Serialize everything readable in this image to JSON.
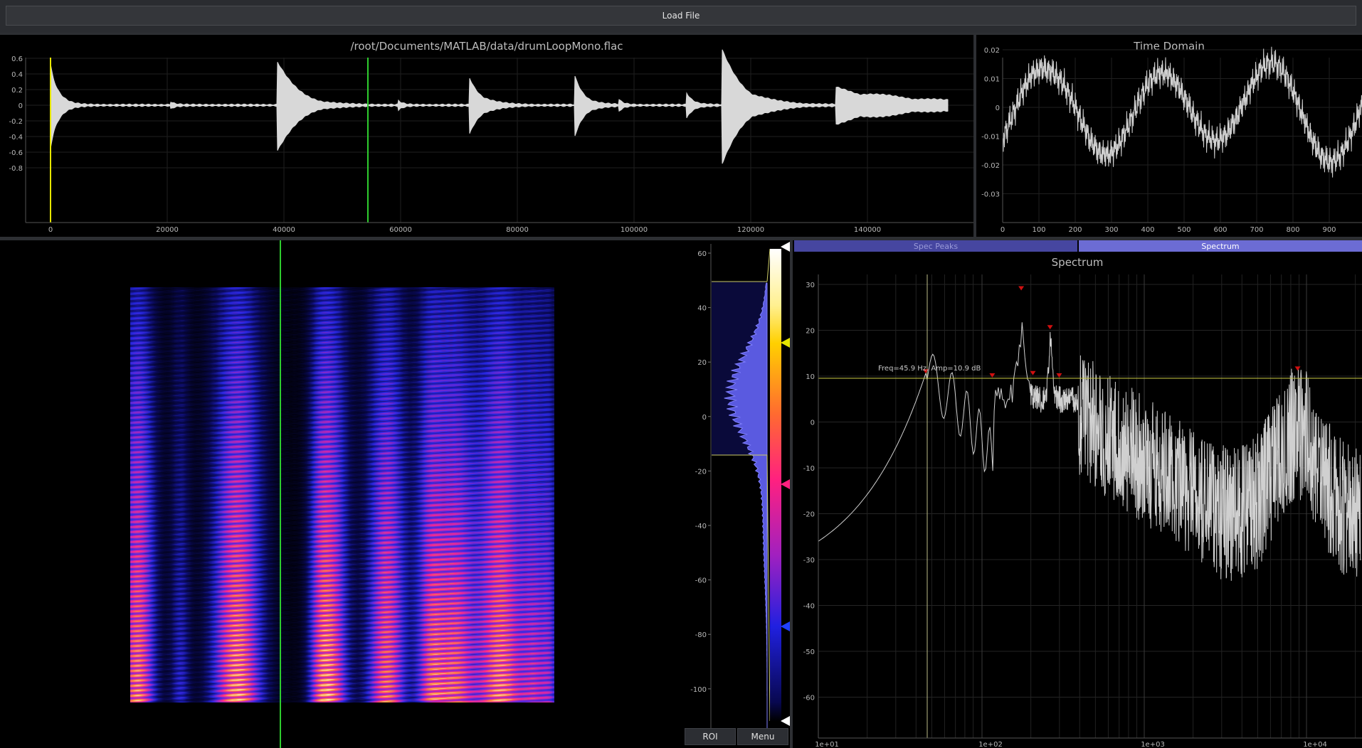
{
  "toolbar": {
    "load_label": "Load File"
  },
  "waveform": {
    "title": "/root/Documents/MATLAB/data/drumLoopMono.flac",
    "y_ticks": [
      "0.6",
      "0.4",
      "0.2",
      "0",
      "-0.2",
      "-0.4",
      "-0.6",
      "-0.8"
    ],
    "x_ticks": [
      "0",
      "20000",
      "40000",
      "60000",
      "80000",
      "100000",
      "140000"
    ],
    "x_ticks_full": [
      "0",
      "20000",
      "40000",
      "60000",
      "80000",
      "100000",
      "120000",
      "140000"
    ]
  },
  "time_domain": {
    "title": "Time Domain",
    "y_ticks": [
      "0.02",
      "0.01",
      "0",
      "-0.01",
      "-0.02",
      "-0.03"
    ],
    "x_ticks": [
      "0",
      "100",
      "200",
      "300",
      "400",
      "500",
      "600",
      "700",
      "800",
      "900"
    ]
  },
  "colorbar": {
    "ticks": [
      "60",
      "40",
      "20",
      "0",
      "-20",
      "-40",
      "-60",
      "-80",
      "-100"
    ]
  },
  "bottom_buttons": {
    "roi": "ROI",
    "menu": "Menu"
  },
  "tabs": {
    "spec_peaks": "Spec Peaks",
    "spectrum": "Spectrum"
  },
  "spectrum": {
    "title": "Spectrum",
    "y_ticks": [
      "30",
      "20",
      "10",
      "0",
      "-10",
      "-20",
      "-30",
      "-40",
      "-50",
      "-60"
    ],
    "x_ticks": [
      "1e+01",
      "1e+02",
      "1e+03",
      "1e+04"
    ],
    "annotation": "Freq=45.9 Hz, Amp=10.9 dB"
  },
  "colors": {
    "accent_tab": "#6c6cd4",
    "tab_inactive": "#4646a0",
    "cursor_green": "#2ecc2e",
    "marker_yellow": "#e6e600",
    "peak_red": "#d01010"
  }
}
